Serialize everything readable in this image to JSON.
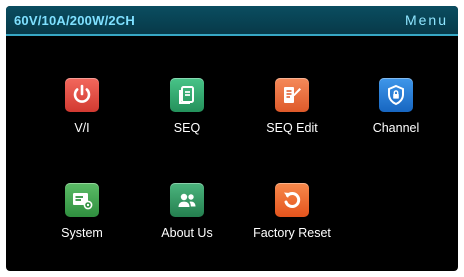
{
  "header": {
    "model": "60V/10A/200W/2CH",
    "menu": "Menu"
  },
  "tiles": [
    {
      "label": "V/I",
      "icon": "power-icon",
      "color": "#e24d43"
    },
    {
      "label": "SEQ",
      "icon": "document-icon",
      "color": "#2ea56c"
    },
    {
      "label": "SEQ Edit",
      "icon": "document-edit-icon",
      "color": "#e96d3c"
    },
    {
      "label": "Channel",
      "icon": "shield-lock-icon",
      "color": "#1f78d1"
    },
    {
      "label": "System",
      "icon": "settings-card-icon",
      "color": "#3fa04f"
    },
    {
      "label": "About Us",
      "icon": "people-icon",
      "color": "#2f9a63"
    },
    {
      "label": "Factory Reset",
      "icon": "reset-icon",
      "color": "#ee6a2f"
    }
  ]
}
